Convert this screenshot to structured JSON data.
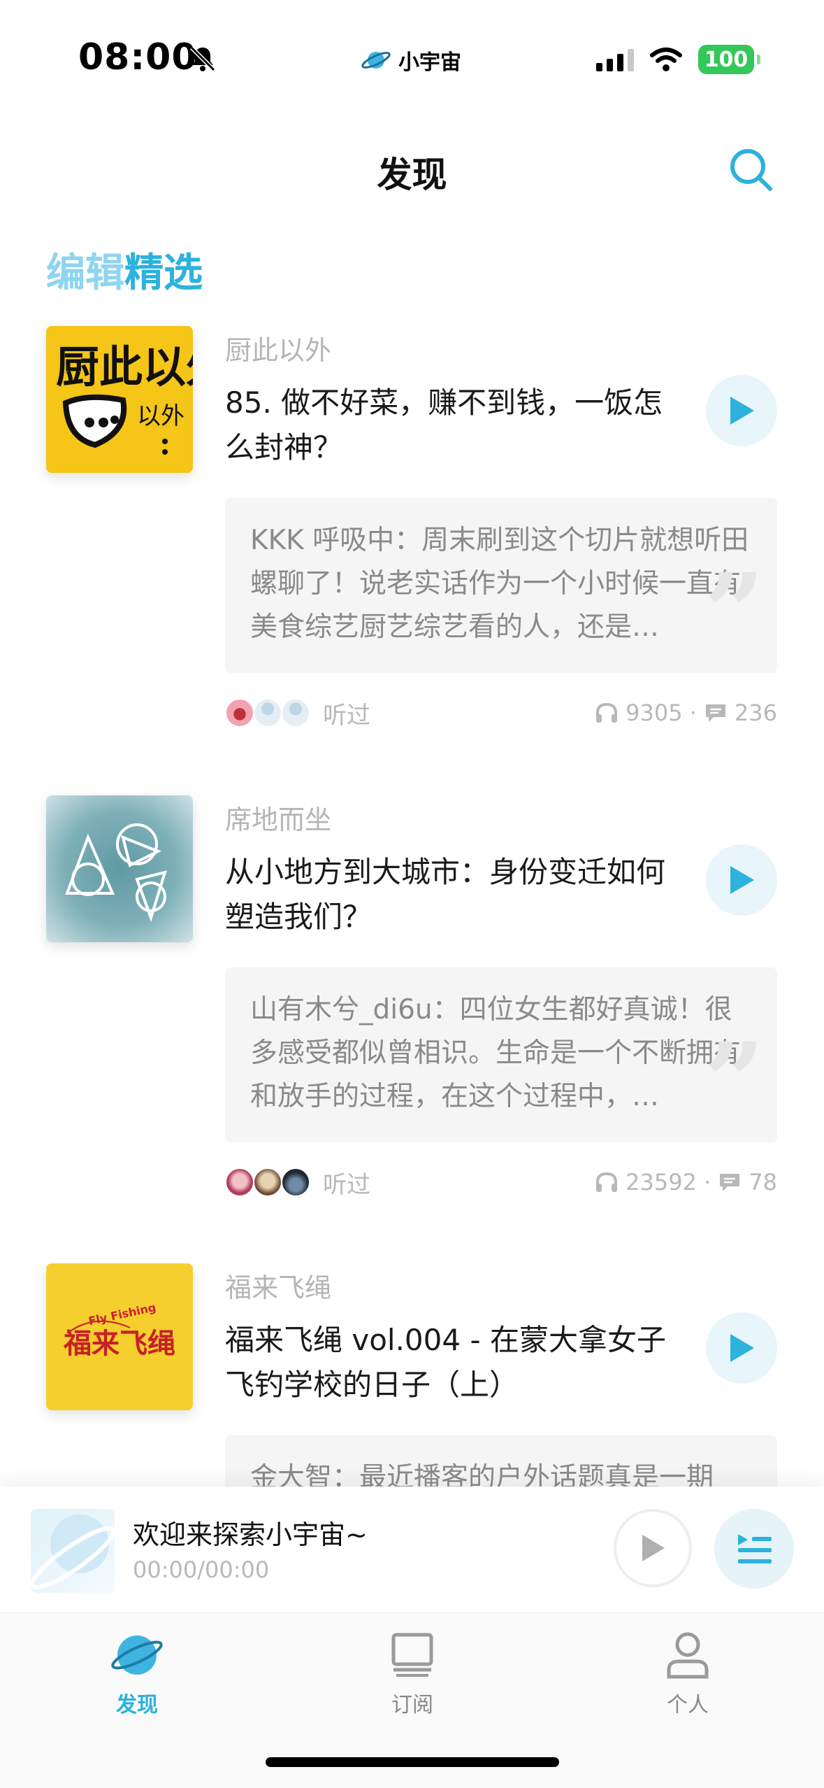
{
  "status_bar": {
    "time": "08:00",
    "app_label": "小宇宙",
    "battery": "100"
  },
  "header": {
    "title": "发现"
  },
  "section": {
    "title_part1": "编辑",
    "title_part2": "精选"
  },
  "episodes": [
    {
      "podcast": "厨此以外",
      "title": "85. 做不好菜，赚不到钱，一饭怎么封神？",
      "comment": "KKK 呼吸中：周末刷到这个切片就想听田螺聊了！说老实话作为一个小时候一直有美食综艺厨艺综艺看的人，还是…",
      "listened_label": "听过",
      "plays": "9305 ·",
      "comments": "236",
      "cover_text": "厨此以外"
    },
    {
      "podcast": "席地而坐",
      "title": "从小地方到大城市：身份变迁如何塑造我们？",
      "comment": "山有木兮_di6u：四位女生都好真诚！很多感受都似曾相识。生命是一个不断拥有和放手的过程，在这个过程中，…",
      "listened_label": "听过",
      "plays": "23592 ·",
      "comments": "78"
    },
    {
      "podcast": "福来飞绳",
      "title": "福来飞绳 vol.004 - 在蒙大拿女子飞钓学校的日子（上）",
      "comment": "金大智：最近播客的户外话题真是一期",
      "cover_text": "福来飞绳",
      "cover_small": "Fly Fishing"
    }
  ],
  "mini_player": {
    "title": "欢迎来探索小宇宙~",
    "time": "00:00/00:00"
  },
  "tabs": [
    {
      "label": "发现",
      "icon": "planet-icon",
      "active": true
    },
    {
      "label": "订阅",
      "icon": "subscribe-icon",
      "active": false
    },
    {
      "label": "个人",
      "icon": "person-icon",
      "active": false
    }
  ],
  "colors": {
    "accent": "#2cb2dc",
    "play_bg": "#e8f5fb",
    "battery": "#34c759"
  }
}
